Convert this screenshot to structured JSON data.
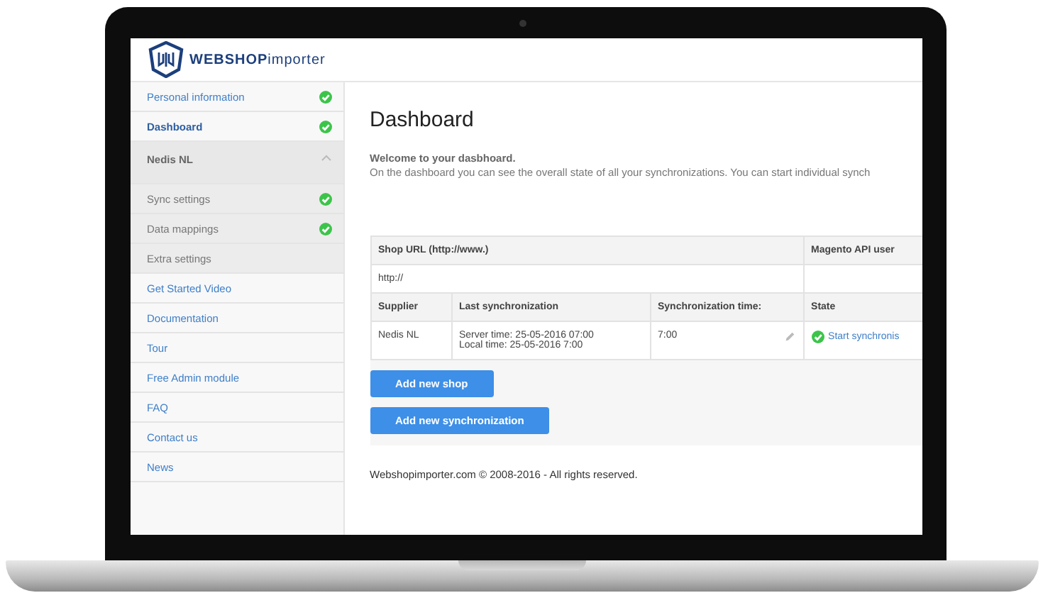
{
  "logo": {
    "text": "**WEBSHOP**importer"
  },
  "sidebar": {
    "items": [
      {
        "kind": "link",
        "label": "Personal information",
        "checked": true,
        "selected": false
      },
      {
        "kind": "link",
        "label": "Dashboard",
        "checked": true,
        "selected": true
      },
      {
        "kind": "group",
        "label": "Nedis NL",
        "expanded": true,
        "selected": false,
        "children": [
          {
            "label": "Sync settings",
            "checked": true,
            "selected": false
          },
          {
            "label": "Data mappings",
            "checked": true,
            "selected": false
          },
          {
            "label": "Extra settings",
            "checked": false,
            "selected": false
          }
        ]
      },
      {
        "kind": "link",
        "label": "Get Started Video",
        "checked": false,
        "selected": false
      },
      {
        "kind": "link",
        "label": "Documentation",
        "checked": false,
        "selected": false
      },
      {
        "kind": "link",
        "label": "Tour",
        "checked": false,
        "selected": false
      },
      {
        "kind": "link",
        "label": "Free Admin module",
        "checked": false,
        "selected": false
      },
      {
        "kind": "link",
        "label": "FAQ",
        "checked": false,
        "selected": false
      },
      {
        "kind": "link",
        "label": "Contact us",
        "checked": false,
        "selected": false
      },
      {
        "kind": "link",
        "label": "News",
        "checked": false,
        "selected": false
      }
    ]
  },
  "main": {
    "title": "Dashboard",
    "welcome": "Welcome to your dasbhoard.",
    "intro": "On the dashboard you can see the overall state of all your synchronizations. You can start individual synch",
    "shop_table": {
      "columns": [
        "Shop URL (http://www.)",
        "Magento API user"
      ],
      "shop_url": "http://"
    },
    "sync_table": {
      "columns": [
        "Supplier",
        "Last synchronization",
        "Synchronization time:",
        "State"
      ],
      "rows": [
        {
          "supplier": "Nedis NL",
          "server_time": "Server time: 25-05-2016 07:00",
          "local_time": "Local time: 25-05-2016 7:00",
          "time": "7:00",
          "ok": true,
          "action": "Start synchronis"
        }
      ]
    },
    "buttons": [
      "Add new shop",
      "Add new synchronization"
    ],
    "footer": "Webshopimporter.com © 2008-2016 - All rights reserved."
  }
}
